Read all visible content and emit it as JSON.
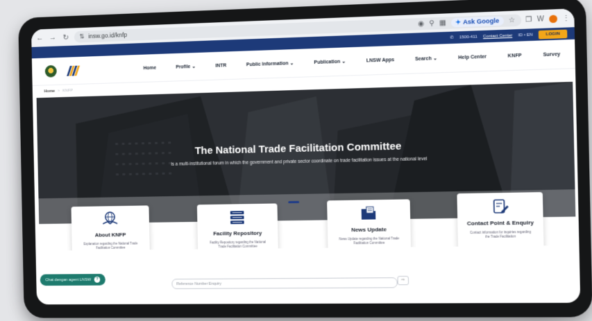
{
  "browser": {
    "url": "insw.go.id/knfp",
    "ask_google": "Ask Google",
    "extension_label": "W"
  },
  "utility": {
    "phone": "1500-411",
    "contact_center": "Contact Center",
    "lang": "ID  •  EN",
    "login": "LOGIN"
  },
  "nav": {
    "items": [
      "Home",
      "Profile ⌄",
      "INTR",
      "Public Information ⌄",
      "Publication ⌄",
      "LNSW Apps",
      "Search ⌄",
      "Help Center",
      "KNFP",
      "Survey"
    ]
  },
  "breadcrumb": {
    "home": "Home",
    "separator": ">",
    "current": "KNFP"
  },
  "hero": {
    "title": "The National Trade Facilitation Committee",
    "subtitle": "is a multi-institutional forum in which the government and private sector coordinate on trade facilitation issues at the national level"
  },
  "cards": [
    {
      "title": "About KNFP",
      "desc": "Explanation regarding the National Trade Facilitation Committee",
      "icon": "globe-handshake-icon"
    },
    {
      "title": "Facility Repository",
      "desc": "Facility Repository regarding the National Trade Facilitation Committee",
      "icon": "stacked-books-icon"
    },
    {
      "title": "News Update",
      "desc": "News Update regarding the National Trade Facilitation Committee",
      "icon": "folder-document-icon"
    },
    {
      "title": "Contact Point & Enquiry",
      "desc": "Contact information for inquiries regarding the Trade Facilitation",
      "icon": "edit-document-icon"
    }
  ],
  "chat": {
    "label": "Chat dengan agent LNSW"
  },
  "reference": {
    "placeholder": "Reference Number Enquiry"
  },
  "colors": {
    "primary_navy": "#1d3a79",
    "login_orange": "#f2a619",
    "chat_teal": "#1e7b6e",
    "frame_black": "#151617"
  }
}
